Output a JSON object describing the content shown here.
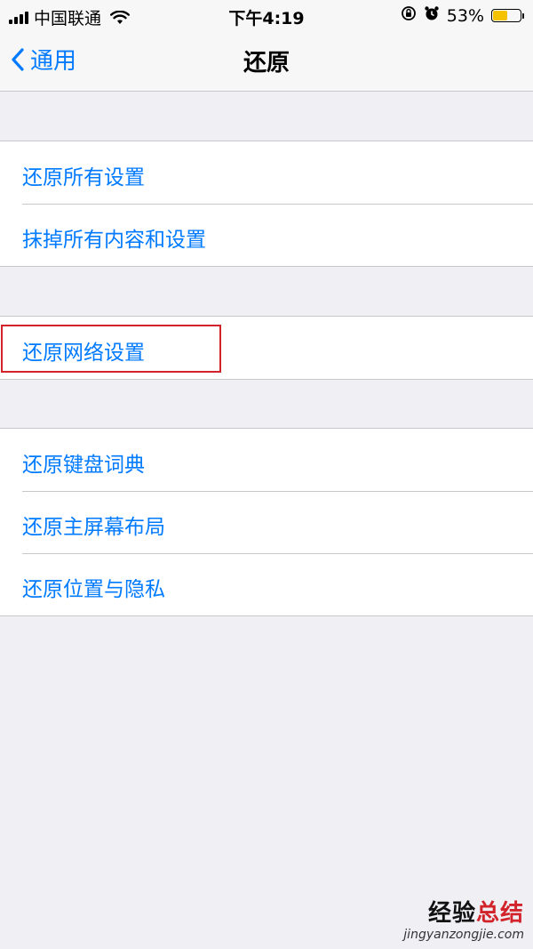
{
  "status_bar": {
    "carrier": "中国联通",
    "time": "下午4:19",
    "battery_percent": "53%",
    "battery_level": 0.53,
    "battery_color": "#f5c200",
    "icons": [
      "signal-icon",
      "wifi-icon",
      "orientation-lock-icon",
      "alarm-icon",
      "battery-icon"
    ]
  },
  "nav": {
    "back_label": "通用",
    "title": "还原"
  },
  "groups": [
    {
      "items": [
        "还原所有设置",
        "抹掉所有内容和设置"
      ]
    },
    {
      "items": [
        "还原网络设置"
      ]
    },
    {
      "items": [
        "还原键盘词典",
        "还原主屏幕布局",
        "还原位置与隐私"
      ]
    }
  ],
  "highlighted_item": "还原网络设置",
  "watermark": {
    "line1_a": "经验",
    "line1_b": "总结",
    "line2": "jingyanzongjie.com"
  },
  "colors": {
    "accent": "#007aff",
    "highlight_border": "#d2232a",
    "background": "#efeff4"
  }
}
